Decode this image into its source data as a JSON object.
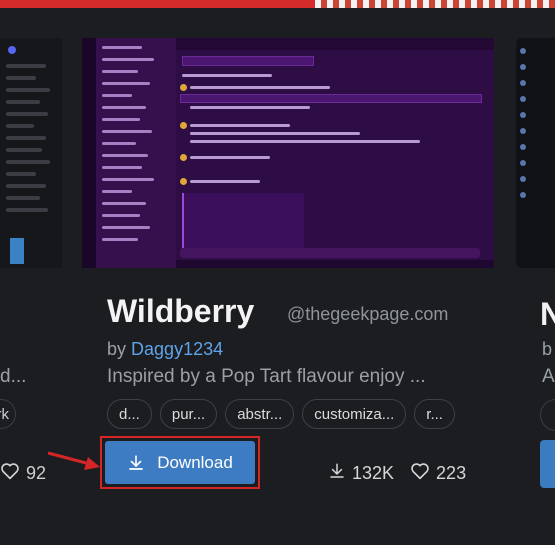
{
  "colors": {
    "accent_blue": "#3d7cc2",
    "link_blue": "#5fa3e8",
    "highlight_red": "#d42626",
    "background": "#1b1d21"
  },
  "left_card": {
    "desc_fragment": "d...",
    "tag_fragment": "rk",
    "likes": "92"
  },
  "main_card": {
    "title": "Wildberry",
    "watermark": "@thegeekpage.com",
    "by_label": "by",
    "author": "Daggy1234",
    "description": "Inspired by a Pop Tart flavour enjoy ...",
    "tags": [
      "d...",
      "pur...",
      "abstr...",
      "customiza...",
      "r..."
    ],
    "download_label": "Download",
    "downloads": "132K",
    "likes": "223"
  },
  "right_card": {
    "title_fragment": "N",
    "by_fragment": "b",
    "desc_fragment": "A"
  },
  "icons": {
    "download": "download-icon",
    "heart": "heart-icon",
    "arrow": "red-arrow-annotation"
  }
}
